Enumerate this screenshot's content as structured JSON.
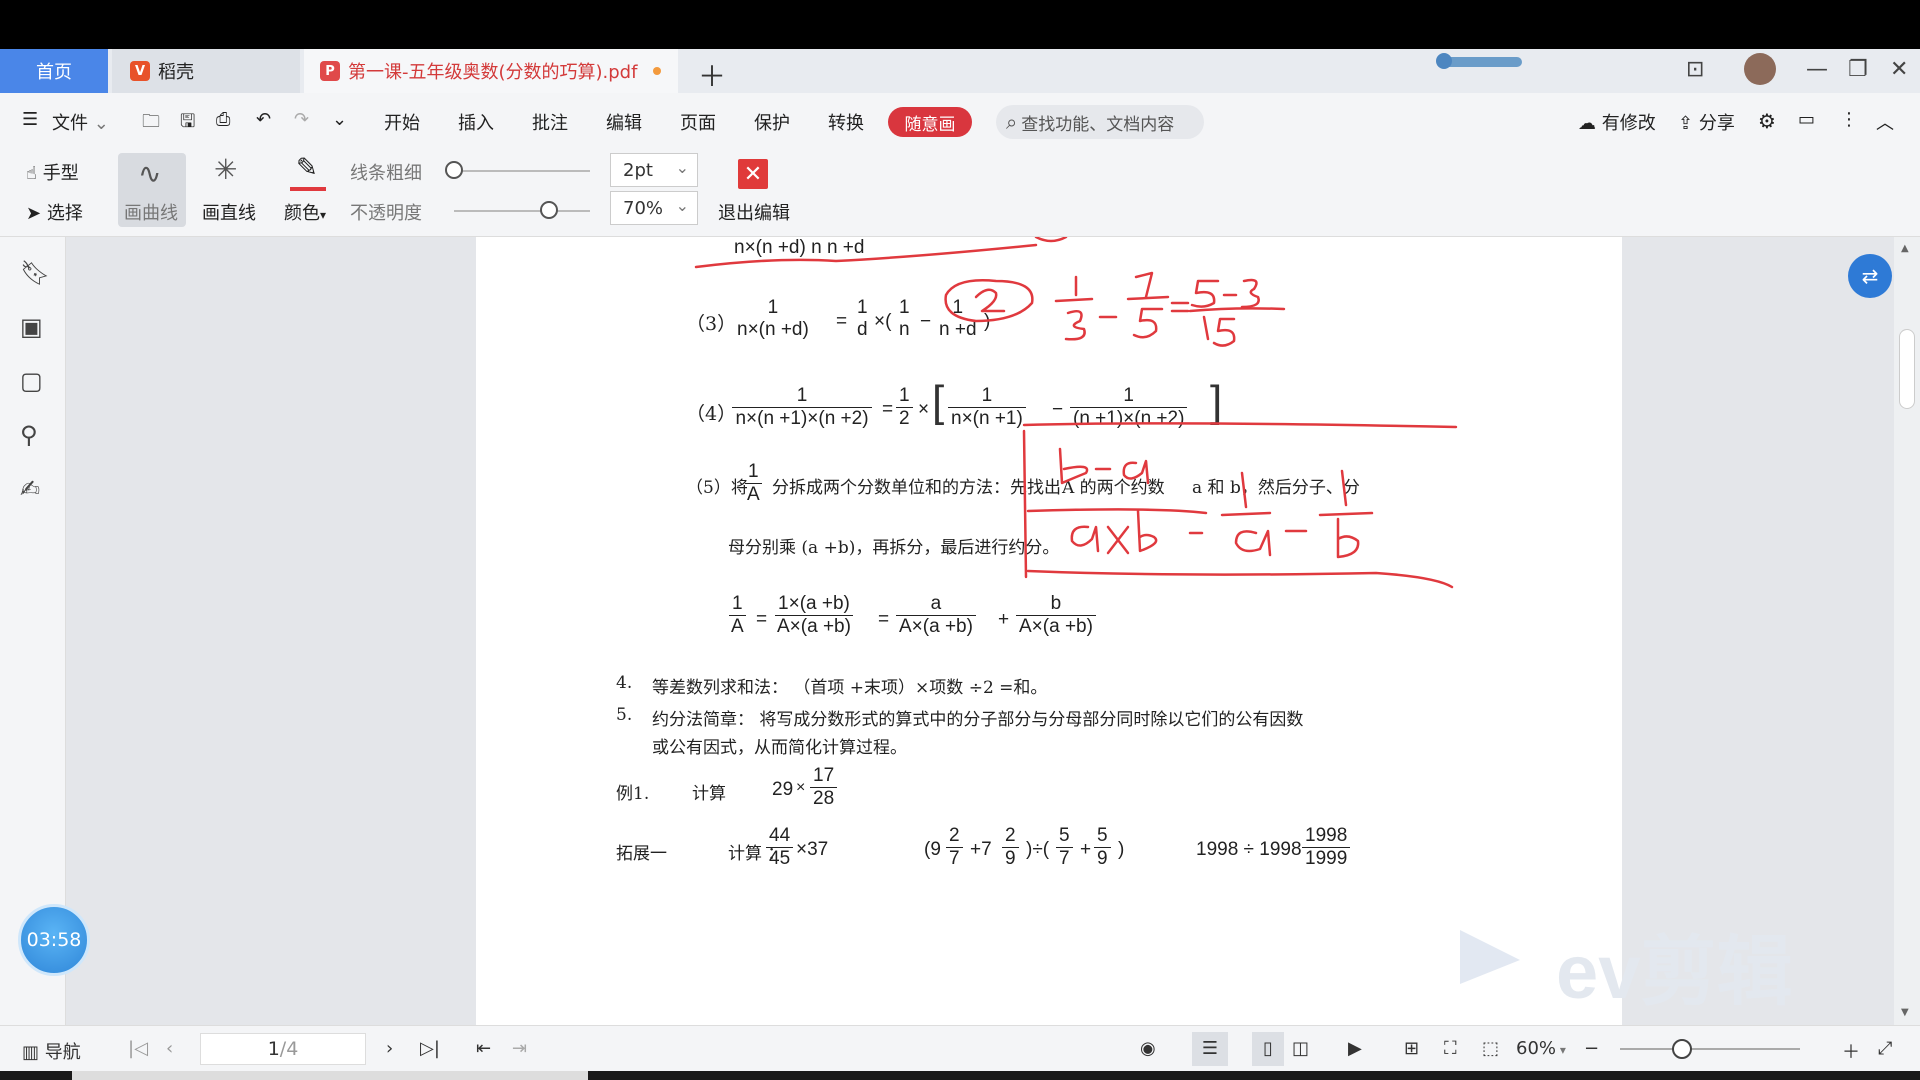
{
  "tabs": [
    {
      "label": "首页"
    },
    {
      "label": "稻壳"
    },
    {
      "label": "第一课-五年级奥数(分数的巧算).pdf"
    }
  ],
  "menu": {
    "file": "文件",
    "items": [
      "开始",
      "插入",
      "批注",
      "编辑",
      "页面",
      "保护",
      "转换"
    ],
    "active": "随意画",
    "search_placeholder": "查找功能、文档内容",
    "modified": "有修改",
    "share": "分享"
  },
  "toolbar": {
    "hand": "手型",
    "select": "选择",
    "curve": "画曲线",
    "line": "画直线",
    "color": "颜色",
    "thickness_label": "线条粗细",
    "opacity_label": "不透明度",
    "thickness_value": "2pt",
    "opacity_value": "70%",
    "exit": "退出编辑",
    "thickness_level": 0.0,
    "opacity_level": 0.7
  },
  "doc": {
    "top_den": "n×(n +d)    n    n +d",
    "l3": "（3）",
    "l4": "（4）",
    "l5_pre": "（5）将",
    "l5_mid": "分拆成两个分数单位和的方法：先找出",
    "l5_a": "A  的两个约数",
    "l5_ab": "a 和 b，然后分子、分",
    "l5_line2": "母分别乘  (a +b)，再拆分，最后进行约分。",
    "f_1": "1",
    "f_n_nd": "n×(n +d)",
    "f_d": "d",
    "f_n": "n",
    "f_nd": "n +d",
    "f_2": "2",
    "f_n3": "n×(n +1)×(n +2)",
    "f_nn1": "n×(n +1)",
    "f_n1n2": "(n +1)×(n +2)",
    "f_A": "A",
    "f_1ab": "1×(a +b)",
    "f_Aab": "A×(a +b)",
    "f_a": "a",
    "f_b": "b",
    "item4_num": "4.",
    "item4": "等差数列求和法：  （首项 +末项）×项数  ÷2 =和。",
    "item5_num": "5.",
    "item5": "约分法简章：   将写成分数形式的算式中的分子部分与分母部分同时除以它们的公有因数",
    "item5_line2": "或公有因式，从而简化计算过程。",
    "ex1": "例1.",
    "calc": "计算",
    "ex1_int": "29",
    "ex1_num": "17",
    "ex1_den": "28",
    "ext1": "拓展一",
    "calc2": "计算  ：",
    "e1_num": "44",
    "e1_den": "45",
    "e1_tail": "×37",
    "e2_9": "(9",
    "e2_n2": "2",
    "e2_d7": "7",
    "e2_plus7": "+7",
    "e2_d9": "9",
    "e2_div": ")÷(",
    "e2_n5": "5",
    "e2_plus": "+",
    "e2_close": ")",
    "e3_pre": "1998 ÷ 1998",
    "e3_num": "1998",
    "e3_den": "1999"
  },
  "timer": "03:58",
  "watermark": "ev剪辑",
  "status": {
    "nav": "导航",
    "page": "1",
    "page_total": "/4",
    "zoom": "60%"
  },
  "colors": {
    "accent": "#4a86e8",
    "active_menu": "#d9363e",
    "ink": "#e0393e"
  }
}
